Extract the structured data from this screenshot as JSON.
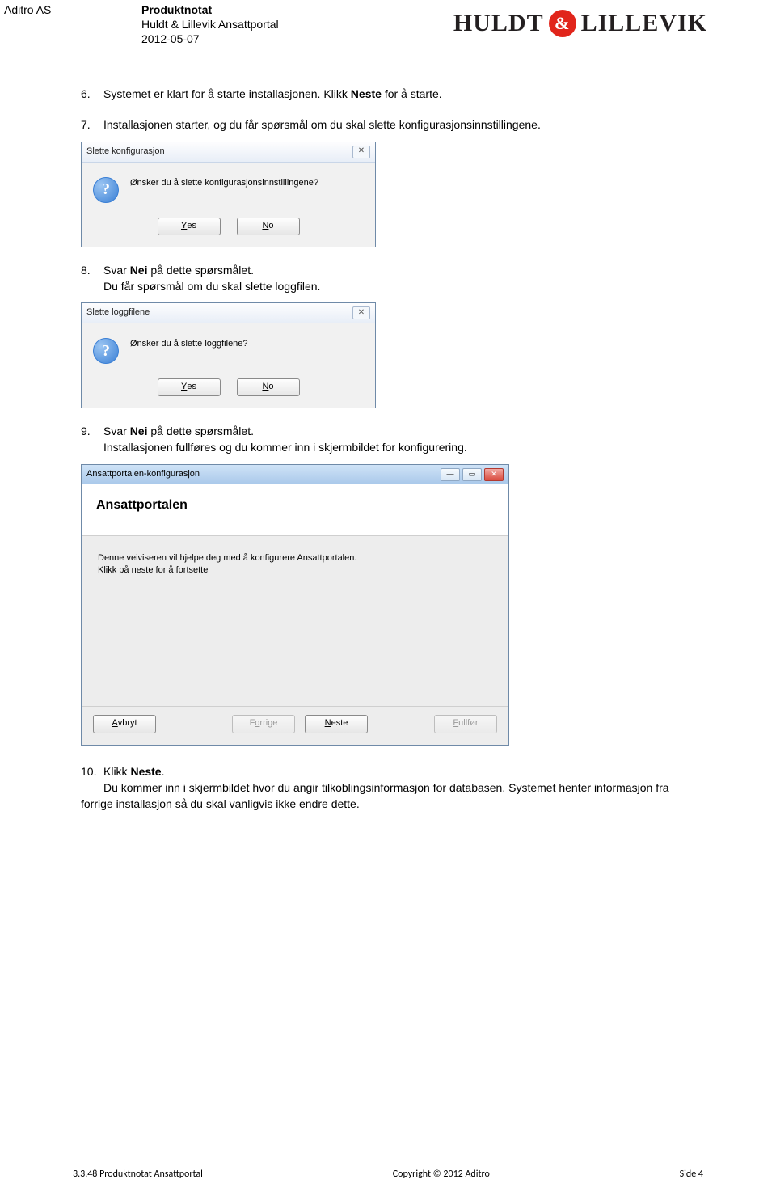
{
  "header": {
    "company": "Aditro AS",
    "title": "Produktnotat",
    "subtitle": "Huldt & Lillevik Ansattportal",
    "date": "2012-05-07",
    "logo_left": "HULDT",
    "logo_amp": "&",
    "logo_right": "LILLEVIK"
  },
  "steps": {
    "s6": {
      "num": "6.",
      "text_a": "Systemet er klart for å starte installasjonen. Klikk ",
      "bold": "Neste",
      "text_b": " for å starte."
    },
    "s7": {
      "num": "7.",
      "text": "Installasjonen starter, og du får spørsmål om du skal slette konfigurasjonsinnstillingene."
    },
    "s8": {
      "num": "8.",
      "text_a": "Svar ",
      "bold": "Nei",
      "text_b": " på dette spørsmålet.",
      "line2": "Du får spørsmål om du skal slette loggfilen."
    },
    "s9": {
      "num": "9.",
      "text_a": "Svar ",
      "bold": "Nei",
      "text_b": " på dette spørsmålet.",
      "line2": "Installasjonen fullføres og du kommer inn i skjermbildet for konfigurering."
    },
    "s10": {
      "num": "10.",
      "text_a": "Klikk ",
      "bold": "Neste",
      "text_b": ".",
      "line2": "Du kommer inn i skjermbildet hvor du angir tilkoblingsinformasjon for databasen. Systemet henter informasjon fra forrige installasjon så du skal vanligvis ikke endre dette."
    }
  },
  "dialog1": {
    "title": "Slette konfigurasjon",
    "question": "Ønsker du å slette konfigurasjonsinnstillingene?",
    "yes": "Yes",
    "yes_u": "Y",
    "no": "No",
    "no_u": "N",
    "close": "✕",
    "icon": "?"
  },
  "dialog2": {
    "title": "Slette loggfilene",
    "question": "Ønsker du å slette loggfilene?",
    "yes": "Yes",
    "yes_u": "Y",
    "no": "No",
    "no_u": "N",
    "close": "✕",
    "icon": "?"
  },
  "wizard": {
    "title": "Ansattportalen-konfigurasjon",
    "heading": "Ansattportalen",
    "body_l1": "Denne veiviseren vil hjelpe deg med å konfigurere Ansattportalen.",
    "body_l2": "Klikk på neste for å fortsette",
    "btn_cancel": "Avbryt",
    "btn_cancel_u": "A",
    "btn_prev": "Forrige",
    "btn_prev_u": "o",
    "btn_next": "Neste",
    "btn_next_u": "N",
    "btn_finish": "Fullfør",
    "btn_finish_u": "F",
    "min": "—",
    "max": "▭",
    "close": "✕"
  },
  "footer": {
    "left": "3.3.48 Produktnotat Ansattportal",
    "center": "Copyright © 2012 Aditro",
    "right": "Side 4"
  }
}
